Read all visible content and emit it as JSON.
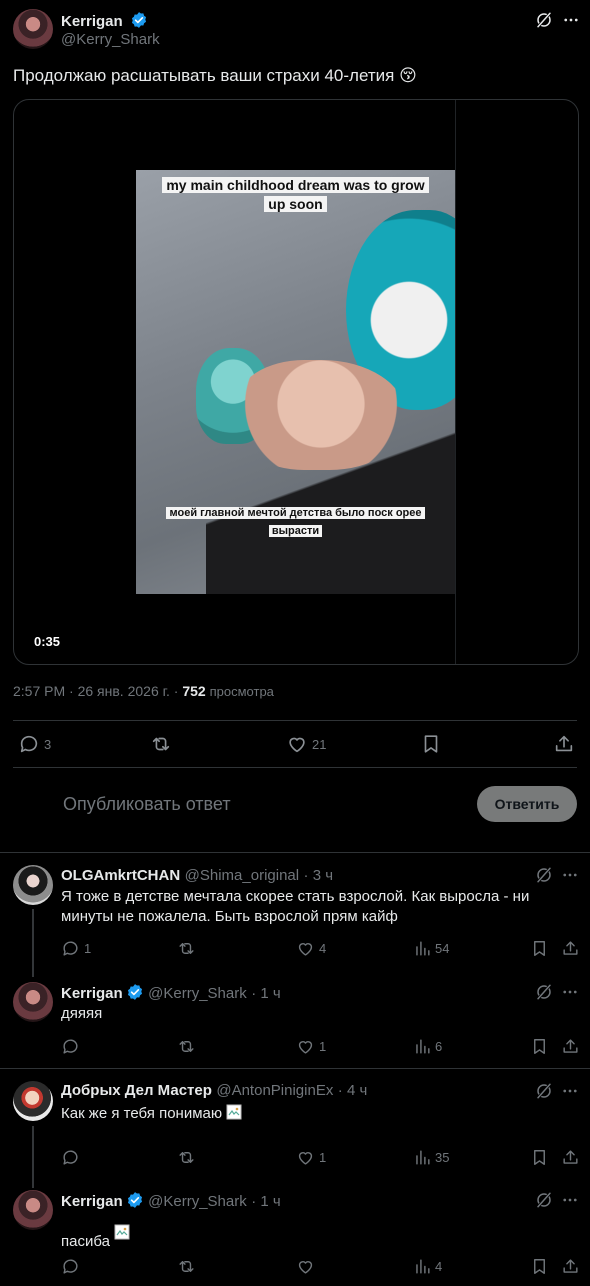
{
  "post": {
    "author_name": "Kerrigan",
    "author_handle": "@Kerry_Shark",
    "text": "Продолжаю расшатывать ваши страхи 40-летия",
    "emoji": "😚",
    "video": {
      "caption_top": "my main childhood dream was to grow up soon",
      "caption_bottom": "моей главной мечтой детства было поск орее вырасти",
      "duration": "0:35"
    },
    "time": "2:57 PM",
    "date": "26 янв. 2026 г.",
    "views_count": "752",
    "views_label": "просмотра",
    "stats": {
      "replies": "3",
      "retweets": "",
      "likes": "21"
    }
  },
  "reply_box": {
    "placeholder": "Опубликовать ответ",
    "button_label": "Ответить"
  },
  "replies": [
    {
      "name": "OLGAmkrtCHAN",
      "handle": "@Shima_original",
      "time": "· 3 ч",
      "text": "Я тоже в детстве мечтала скорее стать взрослой. Как выросла - ни минуты не пожалела. Быть взрослой прям кайф",
      "replies": "1",
      "likes": "4",
      "views": "54"
    },
    {
      "name": "Kerrigan",
      "handle": "@Kerry_Shark",
      "time": "· 1 ч",
      "text": "дяяяя",
      "replies": "",
      "likes": "1",
      "views": "6"
    },
    {
      "name": "Добрых Дел Мастер",
      "handle": "@AntonPiniginEx",
      "time": "· 4 ч",
      "text": "Как же я тебя понимаю",
      "replies": "",
      "likes": "1",
      "views": "35"
    },
    {
      "name": "Kerrigan",
      "handle": "@Kerry_Shark",
      "time": "· 1 ч",
      "text": "пасиба",
      "replies": "",
      "likes": "",
      "views": "4"
    }
  ],
  "colors": {
    "verified": "#1d9bf0",
    "background": "#000000",
    "muted": "#71767b",
    "divider": "#2f3336"
  }
}
